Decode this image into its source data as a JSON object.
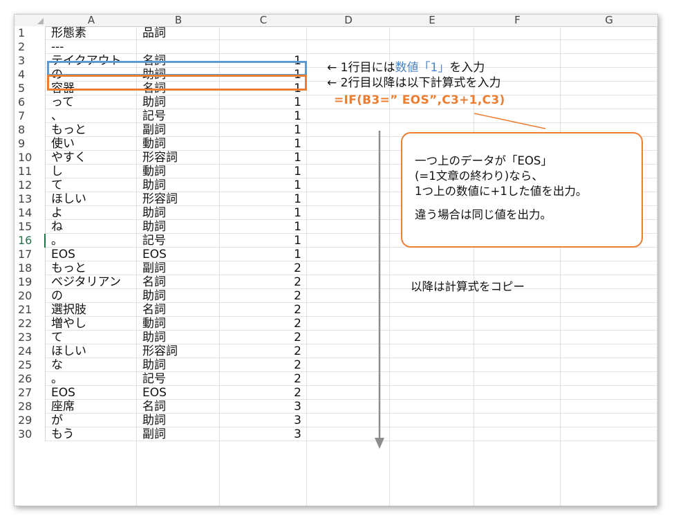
{
  "columns": [
    "A",
    "B",
    "C",
    "D",
    "E",
    "F",
    "G"
  ],
  "rows": [
    {
      "n": "1",
      "a": "形態素",
      "b": "品詞",
      "c": ""
    },
    {
      "n": "2",
      "a": "---",
      "b": "",
      "c": ""
    },
    {
      "n": "3",
      "a": "テイクアウト",
      "b": "名詞",
      "c": "1"
    },
    {
      "n": "4",
      "a": "の",
      "b": "助詞",
      "c": "1"
    },
    {
      "n": "5",
      "a": "容器",
      "b": "名詞",
      "c": "1"
    },
    {
      "n": "6",
      "a": "って",
      "b": "助詞",
      "c": "1"
    },
    {
      "n": "7",
      "a": "、",
      "b": "記号",
      "c": "1"
    },
    {
      "n": "8",
      "a": "もっと",
      "b": "副詞",
      "c": "1"
    },
    {
      "n": "9",
      "a": "使い",
      "b": "動詞",
      "c": "1"
    },
    {
      "n": "10",
      "a": "やすく",
      "b": "形容詞",
      "c": "1"
    },
    {
      "n": "11",
      "a": "し",
      "b": "動詞",
      "c": "1"
    },
    {
      "n": "12",
      "a": "て",
      "b": "助詞",
      "c": "1"
    },
    {
      "n": "13",
      "a": "ほしい",
      "b": "形容詞",
      "c": "1"
    },
    {
      "n": "14",
      "a": "よ",
      "b": "助詞",
      "c": "1"
    },
    {
      "n": "15",
      "a": "ね",
      "b": "助詞",
      "c": "1"
    },
    {
      "n": "16",
      "a": "。",
      "b": "記号",
      "c": "1"
    },
    {
      "n": "17",
      "a": "EOS",
      "b": "EOS",
      "c": "1"
    },
    {
      "n": "18",
      "a": "もっと",
      "b": "副詞",
      "c": "2"
    },
    {
      "n": "19",
      "a": "ベジタリアン",
      "b": "名詞",
      "c": "2"
    },
    {
      "n": "20",
      "a": "の",
      "b": "助詞",
      "c": "2"
    },
    {
      "n": "21",
      "a": "選択肢",
      "b": "名詞",
      "c": "2"
    },
    {
      "n": "22",
      "a": "増やし",
      "b": "動詞",
      "c": "2"
    },
    {
      "n": "23",
      "a": "て",
      "b": "助詞",
      "c": "2"
    },
    {
      "n": "24",
      "a": "ほしい",
      "b": "形容詞",
      "c": "2"
    },
    {
      "n": "25",
      "a": "な",
      "b": "助詞",
      "c": "2"
    },
    {
      "n": "26",
      "a": "。",
      "b": "記号",
      "c": "2"
    },
    {
      "n": "27",
      "a": "EOS",
      "b": "EOS",
      "c": "2"
    },
    {
      "n": "28",
      "a": "座席",
      "b": "名詞",
      "c": "3"
    },
    {
      "n": "29",
      "a": "が",
      "b": "助詞",
      "c": "3"
    },
    {
      "n": "30",
      "a": "もう",
      "b": "副詞",
      "c": "3"
    }
  ],
  "selected_row": "16",
  "annotations": {
    "note1_prefix": "← 1行目には",
    "note1_highlight": "数値「1」",
    "note1_suffix": "を入力",
    "note2": "← 2行目以降は以下計算式を入力",
    "formula": "=IF(B3=” EOS”,C3+1,C3)",
    "callout_line1": "一つ上のデータが「EOS」",
    "callout_line2": "(=1文章の終わり)なら、",
    "callout_line3": "1つ上の数値に+1した値を出力。",
    "callout_line4": "違う場合は同じ値を出力。",
    "copy_note": "以降は計算式をコピー"
  },
  "colors": {
    "highlight_blue": "#5b9bd5",
    "highlight_orange": "#ed7d31",
    "text_blue": "#4a86c8",
    "selection_green": "#217346"
  }
}
